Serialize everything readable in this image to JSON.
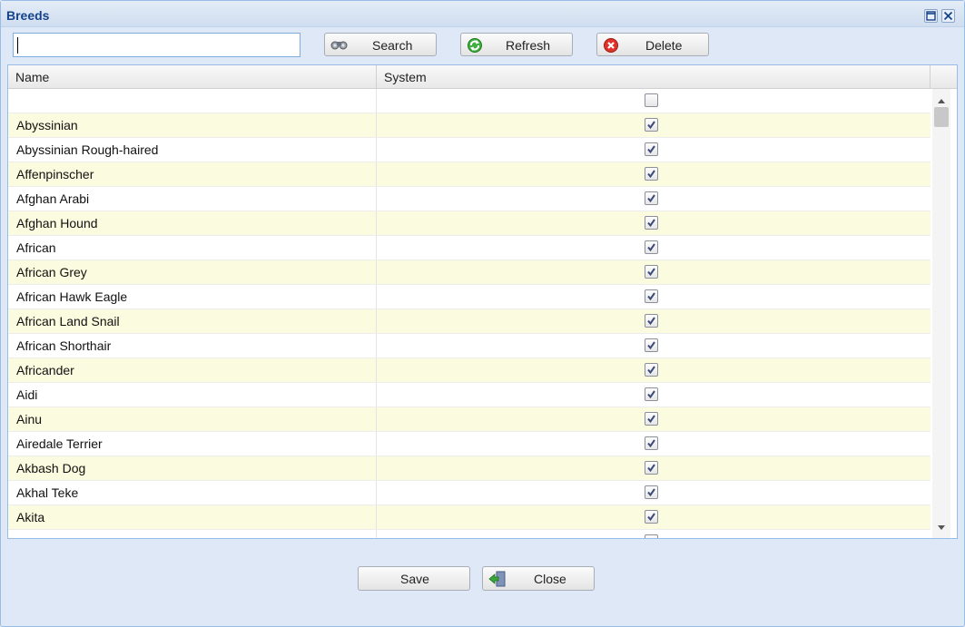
{
  "window": {
    "title": "Breeds"
  },
  "toolbar": {
    "search_value": "",
    "search_label": "Search",
    "refresh_label": "Refresh",
    "delete_label": "Delete"
  },
  "grid": {
    "columns": [
      "Name",
      "System"
    ],
    "rows": [
      {
        "name": "",
        "system": false
      },
      {
        "name": "Abyssinian",
        "system": true
      },
      {
        "name": "Abyssinian Rough-haired",
        "system": true
      },
      {
        "name": "Affenpinscher",
        "system": true
      },
      {
        "name": "Afghan Arabi",
        "system": true
      },
      {
        "name": "Afghan Hound",
        "system": true
      },
      {
        "name": "African",
        "system": true
      },
      {
        "name": "African Grey",
        "system": true
      },
      {
        "name": "African Hawk Eagle",
        "system": true
      },
      {
        "name": "African Land Snail",
        "system": true
      },
      {
        "name": "African Shorthair",
        "system": true
      },
      {
        "name": "Africander",
        "system": true
      },
      {
        "name": "Aidi",
        "system": true
      },
      {
        "name": "Ainu",
        "system": true
      },
      {
        "name": "Airedale Terrier",
        "system": true
      },
      {
        "name": "Akbash Dog",
        "system": true
      },
      {
        "name": "Akhal Teke",
        "system": true
      },
      {
        "name": "Akita",
        "system": true
      },
      {
        "name": "",
        "system": false
      }
    ]
  },
  "footer": {
    "save_label": "Save",
    "close_label": "Close"
  },
  "icons": {
    "search": "binoculars-icon",
    "refresh": "refresh-icon",
    "delete": "delete-icon",
    "close": "exit-door-icon"
  },
  "colors": {
    "title": "#15428b",
    "row_alt": "#fbfbdf",
    "border": "#99bbe8"
  }
}
